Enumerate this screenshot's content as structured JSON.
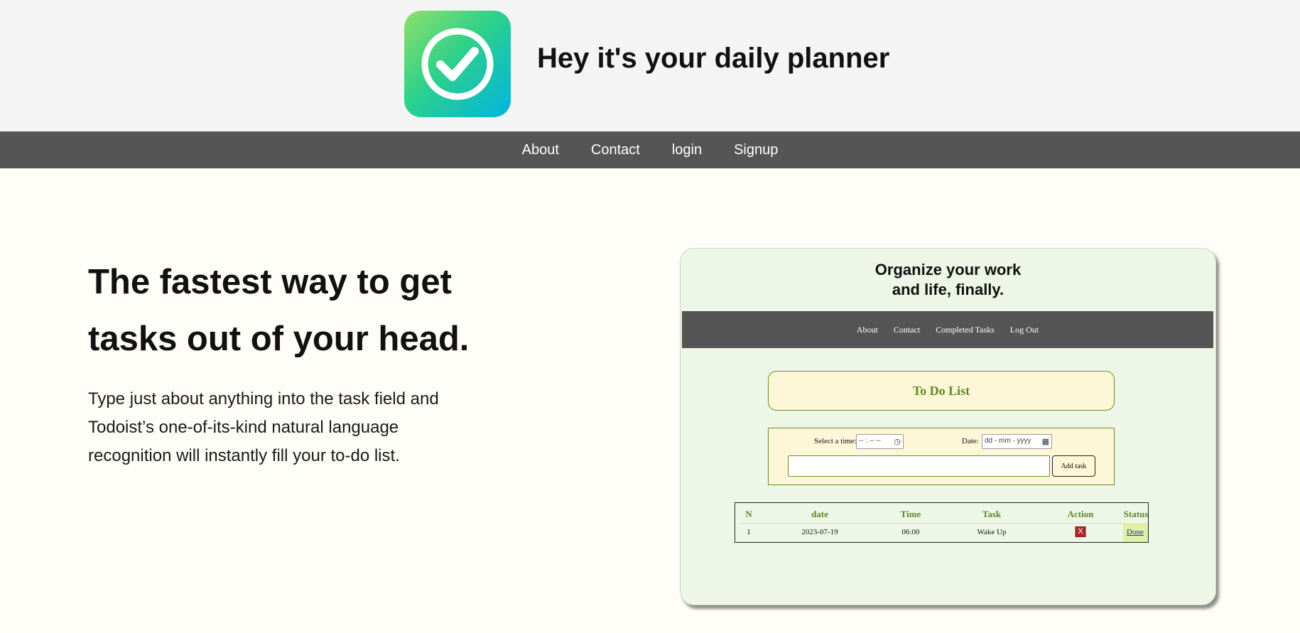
{
  "header": {
    "logo_icon": "check-circle-icon",
    "title": "Hey it's your daily planner"
  },
  "nav": {
    "items": [
      "About",
      "Contact",
      "login",
      "Signup"
    ]
  },
  "hero": {
    "headline": "The fastest way to get tasks out of your head.",
    "description": "Type just about anything into the task field and Todoist’s one-of-its-kind natural language recognition will instantly fill your to-do list."
  },
  "preview": {
    "title_line1": "Organize your work",
    "title_line2": "and life, finally.",
    "nav": [
      "About",
      "Contact",
      "Completed Tasks",
      "Log Out"
    ],
    "todo_title": "To Do List",
    "time_label": "Select a time:",
    "time_placeholder": "-- : --  --",
    "date_label": "Date:",
    "date_placeholder": "dd - mm - yyyy",
    "add_button": "Add task",
    "table": {
      "headers": [
        "N",
        "date",
        "Time",
        "Task",
        "Action",
        "Status"
      ],
      "rows": [
        {
          "n": "1",
          "date": "2023-07-19",
          "time": "06:00",
          "task": "Wake Up",
          "action": "X",
          "status": "Done"
        }
      ]
    }
  },
  "colors": {
    "nav_bg": "#555555",
    "header_bg": "#f4f4f5",
    "accent_green": "#5c8a23",
    "preview_bg": "#eef7e7",
    "todo_bg": "#fdf7d8"
  }
}
